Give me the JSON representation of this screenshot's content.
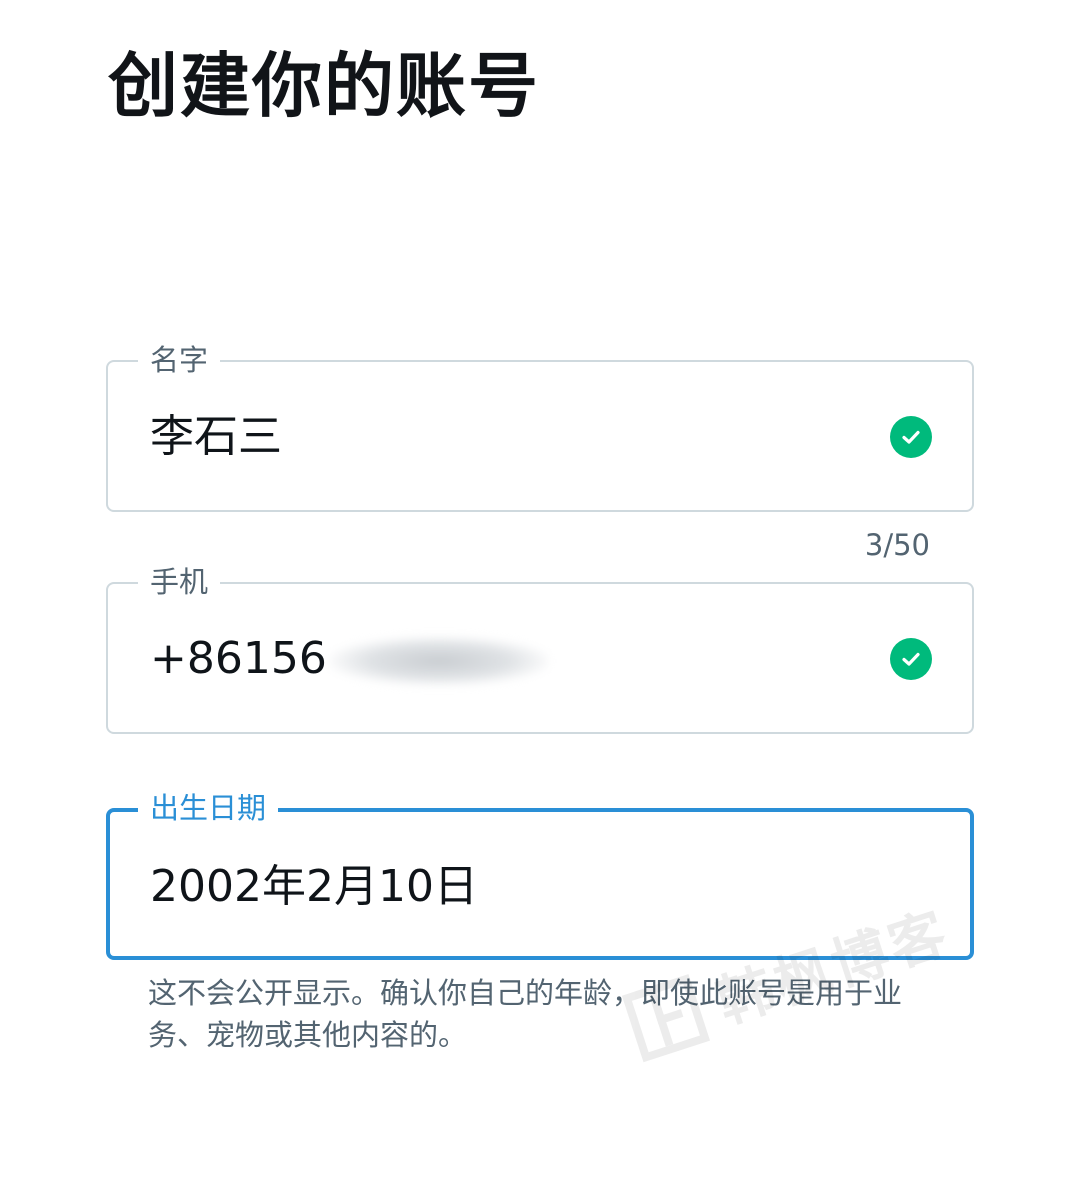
{
  "header": {
    "title": "创建你的账号"
  },
  "form": {
    "name": {
      "label": "名字",
      "value": "李石三",
      "counter": "3/50",
      "status_icon": "check-circle-icon"
    },
    "phone": {
      "label": "手机",
      "value": "+86156",
      "status_icon": "check-circle-icon"
    },
    "birthday": {
      "label": "出生日期",
      "value": "2002年2月10日"
    },
    "help_text": "这不会公开显示。确认你自己的年龄，即使此账号是用于业务、宠物或其他内容的。"
  },
  "watermark": {
    "text": "韩枫博客"
  },
  "colors": {
    "success": "#00ba7c",
    "focus": "#2a8fd6",
    "border": "#cfd9de",
    "muted_text": "#536471"
  }
}
